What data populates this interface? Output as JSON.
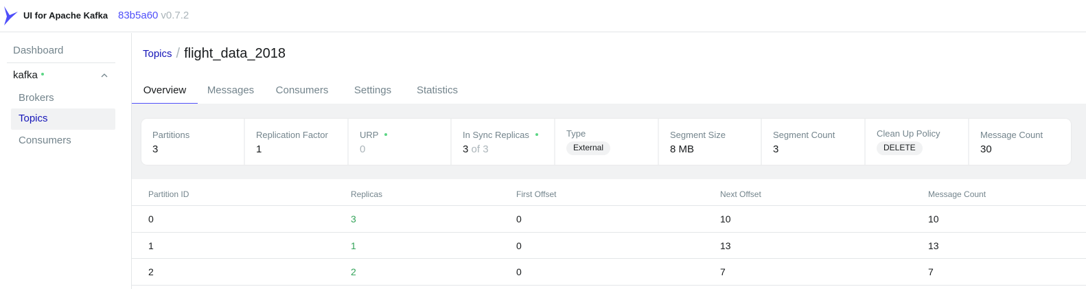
{
  "header": {
    "app_title": "UI for Apache Kafka",
    "version_hash": "83b5a60",
    "version": "v0.7.2",
    "brand_color": "#4f4ffa"
  },
  "sidebar": {
    "dashboard": "Dashboard",
    "cluster": {
      "name": "kafka",
      "status": "online",
      "status_color": "#5cd685"
    },
    "items": [
      {
        "label": "Brokers",
        "active": false
      },
      {
        "label": "Topics",
        "active": true
      },
      {
        "label": "Consumers",
        "active": false
      }
    ]
  },
  "breadcrumb": {
    "parent": "Topics",
    "separator": "/",
    "title": "flight_data_2018"
  },
  "tabs": [
    {
      "label": "Overview",
      "active": true
    },
    {
      "label": "Messages",
      "active": false
    },
    {
      "label": "Consumers",
      "active": false
    },
    {
      "label": "Settings",
      "active": false
    },
    {
      "label": "Statistics",
      "active": false
    }
  ],
  "metrics": {
    "partitions": {
      "label": "Partitions",
      "value": "3"
    },
    "replication_factor": {
      "label": "Replication Factor",
      "value": "1"
    },
    "urp": {
      "label": "URP",
      "value": "0"
    },
    "in_sync_replicas": {
      "label": "In Sync Replicas",
      "value": "3",
      "of_text": "of 3"
    },
    "type": {
      "label": "Type",
      "value": "External"
    },
    "segment_size": {
      "label": "Segment Size",
      "value": "8 MB"
    },
    "segment_count": {
      "label": "Segment Count",
      "value": "3"
    },
    "cleanup_policy": {
      "label": "Clean Up Policy",
      "value": "DELETE"
    },
    "message_count": {
      "label": "Message Count",
      "value": "30"
    }
  },
  "partitions_table": {
    "columns": [
      "Partition ID",
      "Replicas",
      "First Offset",
      "Next Offset",
      "Message Count"
    ],
    "rows": [
      {
        "partition_id": "0",
        "replicas": "3",
        "first_offset": "0",
        "next_offset": "10",
        "message_count": "10"
      },
      {
        "partition_id": "1",
        "replicas": "1",
        "first_offset": "0",
        "next_offset": "13",
        "message_count": "13"
      },
      {
        "partition_id": "2",
        "replicas": "2",
        "first_offset": "0",
        "next_offset": "7",
        "message_count": "7"
      }
    ]
  }
}
